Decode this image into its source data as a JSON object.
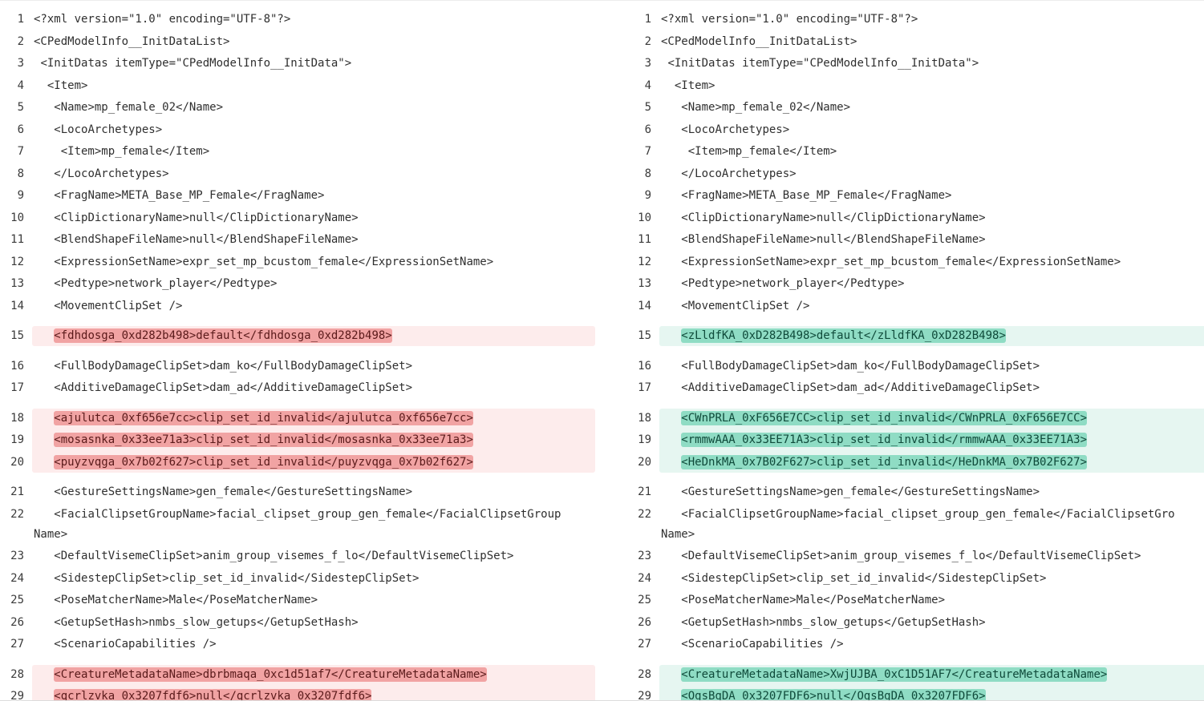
{
  "diff": {
    "left": {
      "lines": [
        {
          "n": "1",
          "indent": "",
          "text": "<?xml version=\"1.0\" encoding=\"UTF-8\"?>"
        },
        {
          "n": "2",
          "indent": "",
          "text": "<CPedModelInfo__InitDataList>"
        },
        {
          "n": "3",
          "indent": " ",
          "text": "<InitDatas itemType=\"CPedModelInfo__InitData\">"
        },
        {
          "n": "4",
          "indent": "  ",
          "text": "<Item>"
        },
        {
          "n": "5",
          "indent": "   ",
          "text": "<Name>mp_female_02</Name>"
        },
        {
          "n": "6",
          "indent": "   ",
          "text": "<LocoArchetypes>"
        },
        {
          "n": "7",
          "indent": "    ",
          "text": "<Item>mp_female</Item>"
        },
        {
          "n": "8",
          "indent": "   ",
          "text": "</LocoArchetypes>"
        },
        {
          "n": "9",
          "indent": "   ",
          "text": "<FragName>META_Base_MP_Female</FragName>"
        },
        {
          "n": "10",
          "indent": "   ",
          "text": "<ClipDictionaryName>null</ClipDictionaryName>"
        },
        {
          "n": "11",
          "indent": "   ",
          "text": "<BlendShapeFileName>null</BlendShapeFileName>"
        },
        {
          "n": "12",
          "indent": "   ",
          "text": "<ExpressionSetName>expr_set_mp_bcustom_female</ExpressionSetName>"
        },
        {
          "n": "13",
          "indent": "   ",
          "text": "<Pedtype>network_player</Pedtype>"
        },
        {
          "n": "14",
          "indent": "   ",
          "text": "<MovementClipSet />"
        },
        {
          "n": "15",
          "indent": "   ",
          "text": "<fdhdosga_0xd282b498>default</fdhdosga_0xd282b498>",
          "changed": true
        },
        {
          "n": "16",
          "indent": "   ",
          "text": "<FullBodyDamageClipSet>dam_ko</FullBodyDamageClipSet>"
        },
        {
          "n": "17",
          "indent": "   ",
          "text": "<AdditiveDamageClipSet>dam_ad</AdditiveDamageClipSet>"
        },
        {
          "n": "18",
          "indent": "   ",
          "text": "<ajulutca_0xf656e7cc>clip_set_id_invalid</ajulutca_0xf656e7cc>",
          "changed": true
        },
        {
          "n": "19",
          "indent": "   ",
          "text": "<mosasnka_0x33ee71a3>clip_set_id_invalid</mosasnka_0x33ee71a3>",
          "changed": true
        },
        {
          "n": "20",
          "indent": "   ",
          "text": "<puyzvqga_0x7b02f627>clip_set_id_invalid</puyzvqga_0x7b02f627>",
          "changed": true
        },
        {
          "n": "21",
          "indent": "   ",
          "text": "<GestureSettingsName>gen_female</GestureSettingsName>"
        },
        {
          "n": "22",
          "indent": "   ",
          "text": "<FacialClipsetGroupName>facial_clipset_group_gen_female</FacialClipsetGroup",
          "cont": "Name>"
        },
        {
          "n": "23",
          "indent": "   ",
          "text": "<DefaultVisemeClipSet>anim_group_visemes_f_lo</DefaultVisemeClipSet>"
        },
        {
          "n": "24",
          "indent": "   ",
          "text": "<SidestepClipSet>clip_set_id_invalid</SidestepClipSet>"
        },
        {
          "n": "25",
          "indent": "   ",
          "text": "<PoseMatcherName>Male</PoseMatcherName>"
        },
        {
          "n": "26",
          "indent": "   ",
          "text": "<GetupSetHash>nmbs_slow_getups</GetupSetHash>"
        },
        {
          "n": "27",
          "indent": "   ",
          "text": "<ScenarioCapabilities />"
        },
        {
          "n": "28",
          "indent": "   ",
          "text": "<CreatureMetadataName>dbrbmaqa_0xc1d51af7</CreatureMetadataName>",
          "changed": true
        },
        {
          "n": "29",
          "indent": "   ",
          "text": "<qcrlzvka_0x3207fdf6>null</qcrlzvka_0x3207fdf6>",
          "changed": true
        }
      ]
    },
    "right": {
      "lines": [
        {
          "n": "1",
          "indent": "",
          "text": "<?xml version=\"1.0\" encoding=\"UTF-8\"?>"
        },
        {
          "n": "2",
          "indent": "",
          "text": "<CPedModelInfo__InitDataList>"
        },
        {
          "n": "3",
          "indent": " ",
          "text": "<InitDatas itemType=\"CPedModelInfo__InitData\">"
        },
        {
          "n": "4",
          "indent": "  ",
          "text": "<Item>"
        },
        {
          "n": "5",
          "indent": "   ",
          "text": "<Name>mp_female_02</Name>"
        },
        {
          "n": "6",
          "indent": "   ",
          "text": "<LocoArchetypes>"
        },
        {
          "n": "7",
          "indent": "    ",
          "text": "<Item>mp_female</Item>"
        },
        {
          "n": "8",
          "indent": "   ",
          "text": "</LocoArchetypes>"
        },
        {
          "n": "9",
          "indent": "   ",
          "text": "<FragName>META_Base_MP_Female</FragName>"
        },
        {
          "n": "10",
          "indent": "   ",
          "text": "<ClipDictionaryName>null</ClipDictionaryName>"
        },
        {
          "n": "11",
          "indent": "   ",
          "text": "<BlendShapeFileName>null</BlendShapeFileName>"
        },
        {
          "n": "12",
          "indent": "   ",
          "text": "<ExpressionSetName>expr_set_mp_bcustom_female</ExpressionSetName>"
        },
        {
          "n": "13",
          "indent": "   ",
          "text": "<Pedtype>network_player</Pedtype>"
        },
        {
          "n": "14",
          "indent": "   ",
          "text": "<MovementClipSet />"
        },
        {
          "n": "15",
          "indent": "   ",
          "text": "<zLldfKA_0xD282B498>default</zLldfKA_0xD282B498>",
          "changed": true
        },
        {
          "n": "16",
          "indent": "   ",
          "text": "<FullBodyDamageClipSet>dam_ko</FullBodyDamageClipSet>"
        },
        {
          "n": "17",
          "indent": "   ",
          "text": "<AdditiveDamageClipSet>dam_ad</AdditiveDamageClipSet>"
        },
        {
          "n": "18",
          "indent": "   ",
          "text": "<CWnPRLA_0xF656E7CC>clip_set_id_invalid</CWnPRLA_0xF656E7CC>",
          "changed": true
        },
        {
          "n": "19",
          "indent": "   ",
          "text": "<rmmwAAA_0x33EE71A3>clip_set_id_invalid</rmmwAAA_0x33EE71A3>",
          "changed": true
        },
        {
          "n": "20",
          "indent": "   ",
          "text": "<HeDnkMA_0x7B02F627>clip_set_id_invalid</HeDnkMA_0x7B02F627>",
          "changed": true
        },
        {
          "n": "21",
          "indent": "   ",
          "text": "<GestureSettingsName>gen_female</GestureSettingsName>"
        },
        {
          "n": "22",
          "indent": "   ",
          "text": "<FacialClipsetGroupName>facial_clipset_group_gen_female</FacialClipsetGro",
          "cont": "Name>"
        },
        {
          "n": "23",
          "indent": "   ",
          "text": "<DefaultVisemeClipSet>anim_group_visemes_f_lo</DefaultVisemeClipSet>"
        },
        {
          "n": "24",
          "indent": "   ",
          "text": "<SidestepClipSet>clip_set_id_invalid</SidestepClipSet>"
        },
        {
          "n": "25",
          "indent": "   ",
          "text": "<PoseMatcherName>Male</PoseMatcherName>"
        },
        {
          "n": "26",
          "indent": "   ",
          "text": "<GetupSetHash>nmbs_slow_getups</GetupSetHash>"
        },
        {
          "n": "27",
          "indent": "   ",
          "text": "<ScenarioCapabilities />"
        },
        {
          "n": "28",
          "indent": "   ",
          "text": "<CreatureMetadataName>XwjUJBA_0xC1D51AF7</CreatureMetadataName>",
          "changed": true
        },
        {
          "n": "29",
          "indent": "   ",
          "text": "<OgsBgDA_0x3207FDF6>null</OgsBgDA_0x3207FDF6>",
          "changed": true
        }
      ]
    }
  }
}
